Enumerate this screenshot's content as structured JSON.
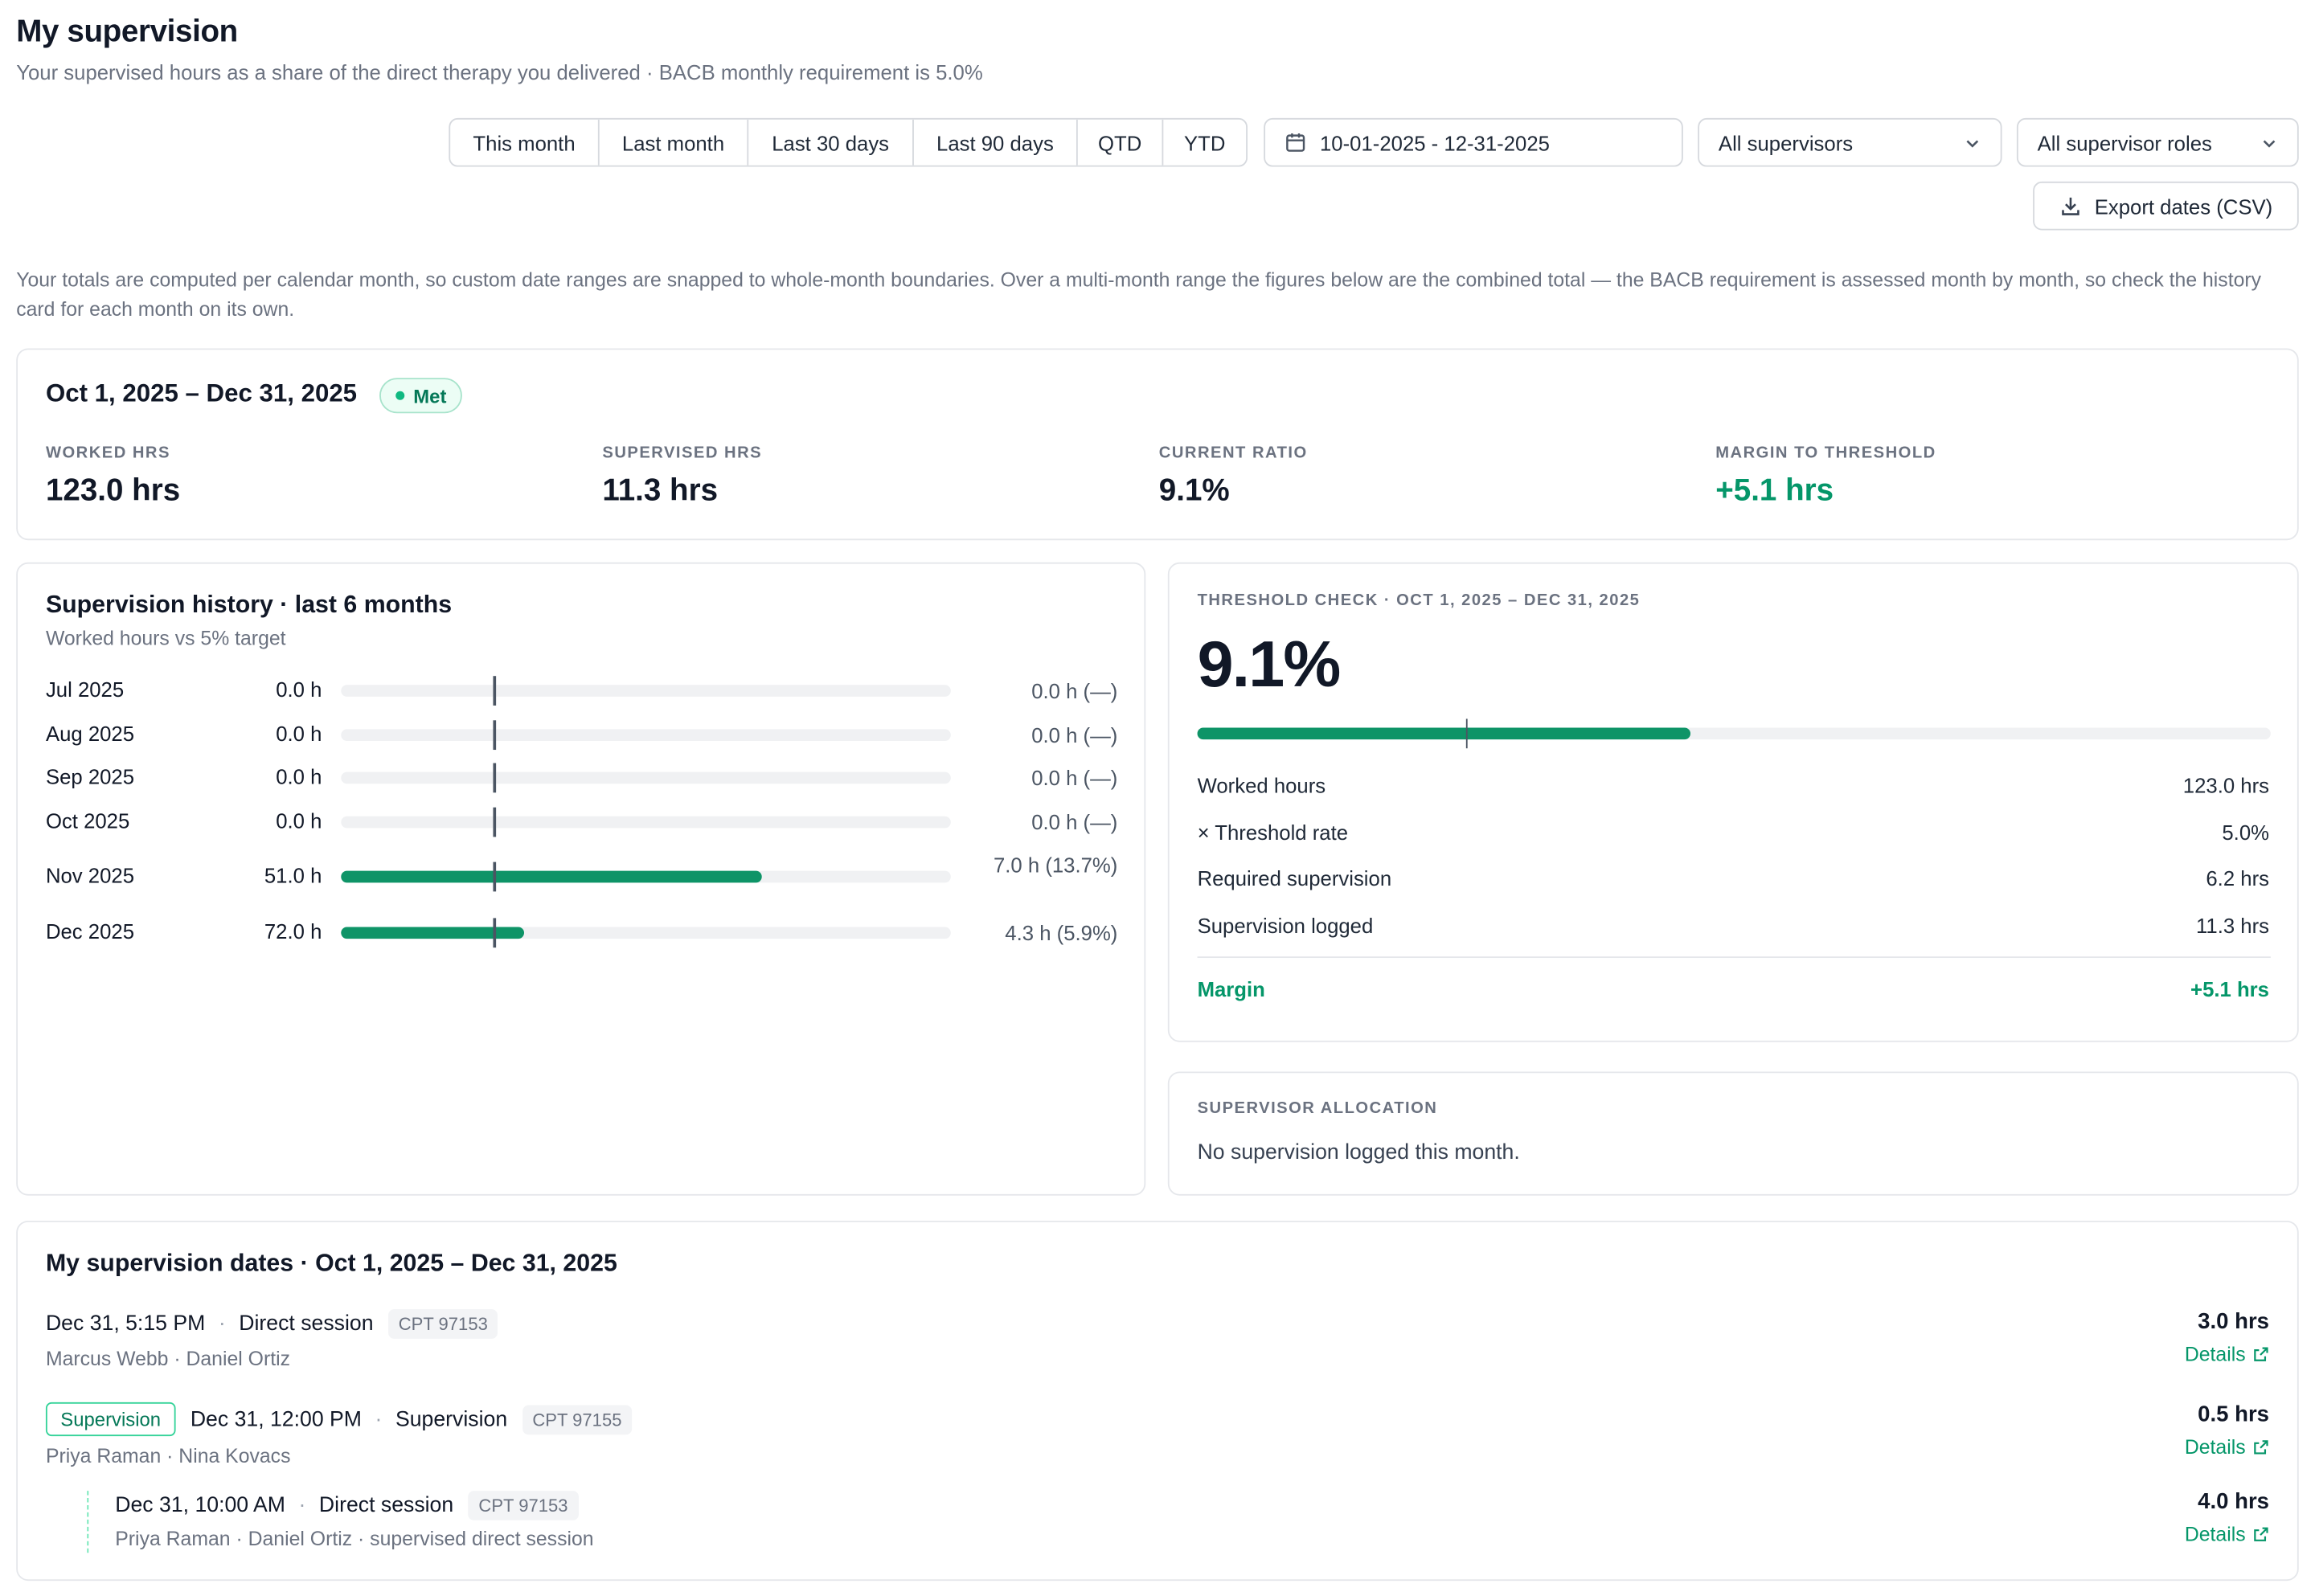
{
  "header": {
    "title": "My supervision",
    "subtitle": "Your supervised hours as a share of the direct therapy you delivered · BACB monthly requirement is 5.0%"
  },
  "filters": {
    "ranges": [
      "This month",
      "Last month",
      "Last 30 days",
      "Last 90 days",
      "QTD",
      "YTD"
    ],
    "date_range": "10-01-2025 - 12-31-2025",
    "supervisor_select": "All supervisors",
    "role_select": "All supervisor roles",
    "export_label": "Export dates (CSV)"
  },
  "note": "Your totals are computed per calendar month, so custom date ranges are snapped to whole-month boundaries. Over a multi-month range the figures below are the combined total — the BACB requirement is assessed month by month, so check the history card for each month on its own.",
  "summary": {
    "period": "Oct 1, 2025 – Dec 31, 2025",
    "status": "Met",
    "kpis": [
      {
        "label": "WORKED HRS",
        "value": "123.0 hrs"
      },
      {
        "label": "SUPERVISED HRS",
        "value": "11.3 hrs"
      },
      {
        "label": "CURRENT RATIO",
        "value": "9.1%"
      },
      {
        "label": "MARGIN TO THRESHOLD",
        "value": "+5.1 hrs"
      }
    ]
  },
  "history": {
    "title": "Supervision history · last 6 months",
    "subtitle": "Worked hours vs 5% target",
    "target_fraction": 0.25,
    "rows": [
      {
        "month": "Jul 2025",
        "worked": "0.0 h",
        "supervised": "0.0 h (—)",
        "fill": 0
      },
      {
        "month": "Aug 2025",
        "worked": "0.0 h",
        "supervised": "0.0 h (—)",
        "fill": 0
      },
      {
        "month": "Sep 2025",
        "worked": "0.0 h",
        "supervised": "0.0 h (—)",
        "fill": 0
      },
      {
        "month": "Oct 2025",
        "worked": "0.0 h",
        "supervised": "0.0 h (—)",
        "fill": 0
      },
      {
        "month": "Nov 2025",
        "worked": "51.0 h",
        "supervised": "7.0 h (13.7%)",
        "fill": 0.69
      },
      {
        "month": "Dec 2025",
        "worked": "72.0 h",
        "supervised": "4.3 h (5.9%)",
        "fill": 0.3
      }
    ]
  },
  "threshold": {
    "label": "THRESHOLD CHECK · OCT 1, 2025 – DEC 31, 2025",
    "ratio": "9.1%",
    "fill": 0.46,
    "target_fraction": 0.25,
    "rows": [
      {
        "label": "Worked hours",
        "value": "123.0 hrs"
      },
      {
        "label": "× Threshold rate",
        "value": "5.0%"
      },
      {
        "label": "Required supervision",
        "value": "6.2 hrs"
      },
      {
        "label": "Supervision logged",
        "value": "11.3 hrs"
      }
    ],
    "margin_label": "Margin",
    "margin_value": "+5.1 hrs"
  },
  "allocation": {
    "label": "SUPERVISOR ALLOCATION",
    "text": "No supervision logged this month."
  },
  "dates": {
    "title": "My supervision dates · Oct 1, 2025 – Dec 31, 2025",
    "details_label": "Details",
    "entries": [
      {
        "when": "Dec 31, 5:15 PM",
        "type": "Direct session",
        "cpt": "CPT 97153",
        "people": "Marcus Webb · Daniel Ortiz",
        "hours": "3.0 hrs"
      },
      {
        "badge": "Supervision",
        "when": "Dec 31, 12:00 PM",
        "type": "Supervision",
        "cpt": "CPT 97155",
        "people": "Priya Raman · Nina Kovacs",
        "hours": "0.5 hrs"
      },
      {
        "when": "Dec 31, 10:00 AM",
        "type": "Direct session",
        "cpt": "CPT 97153",
        "people": "Priya Raman · Daniel Ortiz · supervised direct session",
        "hours": "4.0 hrs"
      }
    ]
  },
  "colors": {
    "accent": "#0e9467",
    "met_badge": "#047857",
    "muted": "#6b7280"
  }
}
